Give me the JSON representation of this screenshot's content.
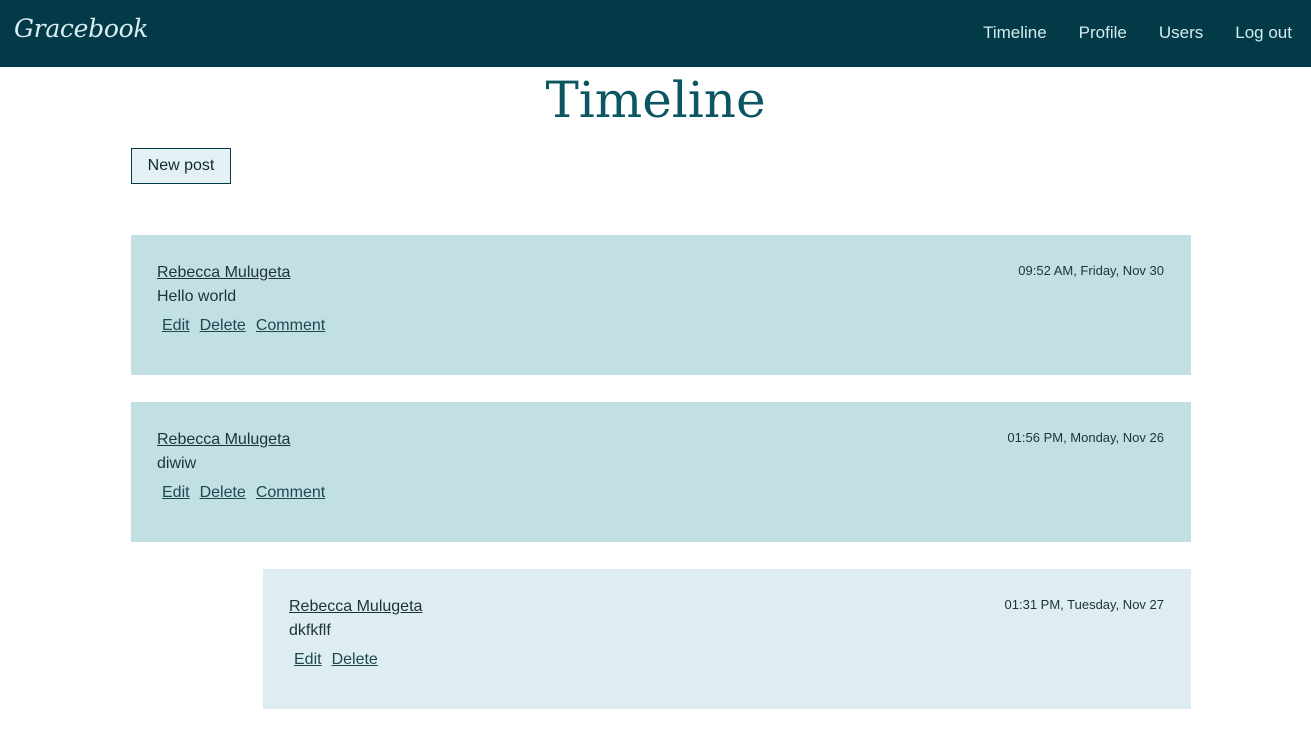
{
  "navbar": {
    "brand": "Gracebook",
    "links": [
      "Timeline",
      "Profile",
      "Users",
      "Log out"
    ]
  },
  "page": {
    "title": "Timeline",
    "new_post_label": "New post"
  },
  "posts": [
    {
      "author": "Rebecca Mulugeta",
      "body": "Hello world",
      "timestamp": "09:52 AM, Friday, Nov 30",
      "actions": [
        "Edit",
        "Delete",
        "Comment"
      ]
    },
    {
      "author": "Rebecca Mulugeta",
      "body": "diwiw",
      "timestamp": "01:56 PM, Monday, Nov 26",
      "actions": [
        "Edit",
        "Delete",
        "Comment"
      ]
    },
    {
      "author": "Rebecca Mulugeta",
      "body": "dkfkflf",
      "timestamp": "01:31 PM, Tuesday, Nov 27",
      "actions": [
        "Edit",
        "Delete"
      ]
    }
  ],
  "colors": {
    "navbar_bg": "#033a47",
    "post_bg": "#c2dfe4",
    "comment_bg": "#ddedf1",
    "title": "#0b5660"
  }
}
